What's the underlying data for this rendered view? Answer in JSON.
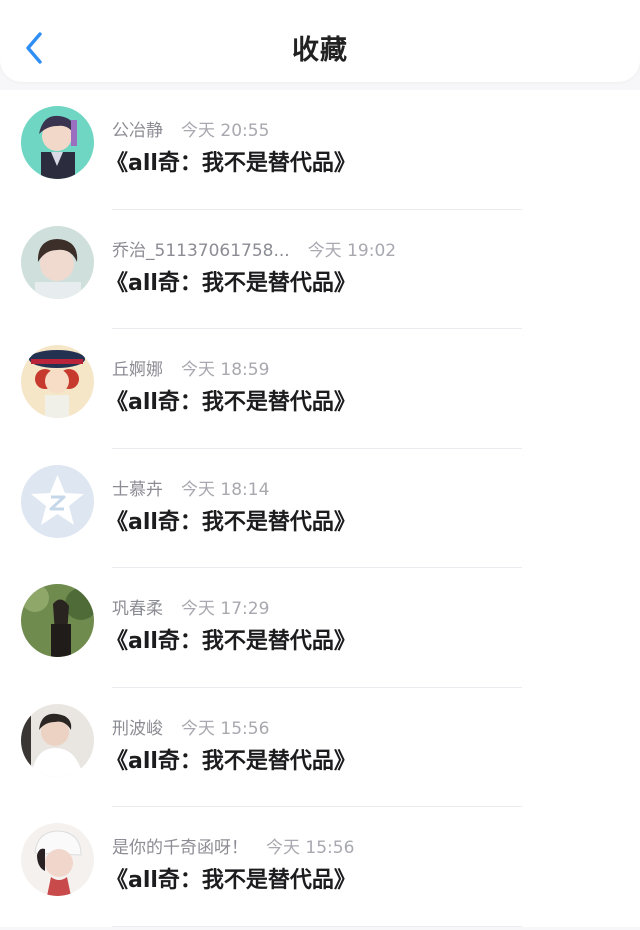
{
  "header": {
    "title": "收藏",
    "back_icon": "chevron-left-icon",
    "accent_color": "#2f8ef4"
  },
  "items": [
    {
      "name": "公冶静",
      "time": "今天 20:55",
      "message": "《all奇：我不是替代品》",
      "avatar": "avatar-anime-boy"
    },
    {
      "name": "乔治_51137061758...",
      "time": "今天 19:02",
      "message": "《all奇：我不是替代品》",
      "avatar": "avatar-photo-man"
    },
    {
      "name": "丘婀娜",
      "time": "今天 18:59",
      "message": "《all奇：我不是替代品》",
      "avatar": "avatar-illustrated-girl-hat"
    },
    {
      "name": "士慕卉",
      "time": "今天 18:14",
      "message": "《all奇：我不是替代品》",
      "avatar": "avatar-default-qzone-star"
    },
    {
      "name": "巩春柔",
      "time": "今天 17:29",
      "message": "《all奇：我不是替代品》",
      "avatar": "avatar-photo-forest-girl"
    },
    {
      "name": "刑波峻",
      "time": "今天 15:56",
      "message": "《all奇：我不是替代品》",
      "avatar": "avatar-photo-man-white-shirt"
    },
    {
      "name": "是你的千奇函呀！",
      "time": "今天 15:56",
      "message": "《all奇：我不是替代品》",
      "avatar": "avatar-photo-girl-white-cap"
    }
  ]
}
